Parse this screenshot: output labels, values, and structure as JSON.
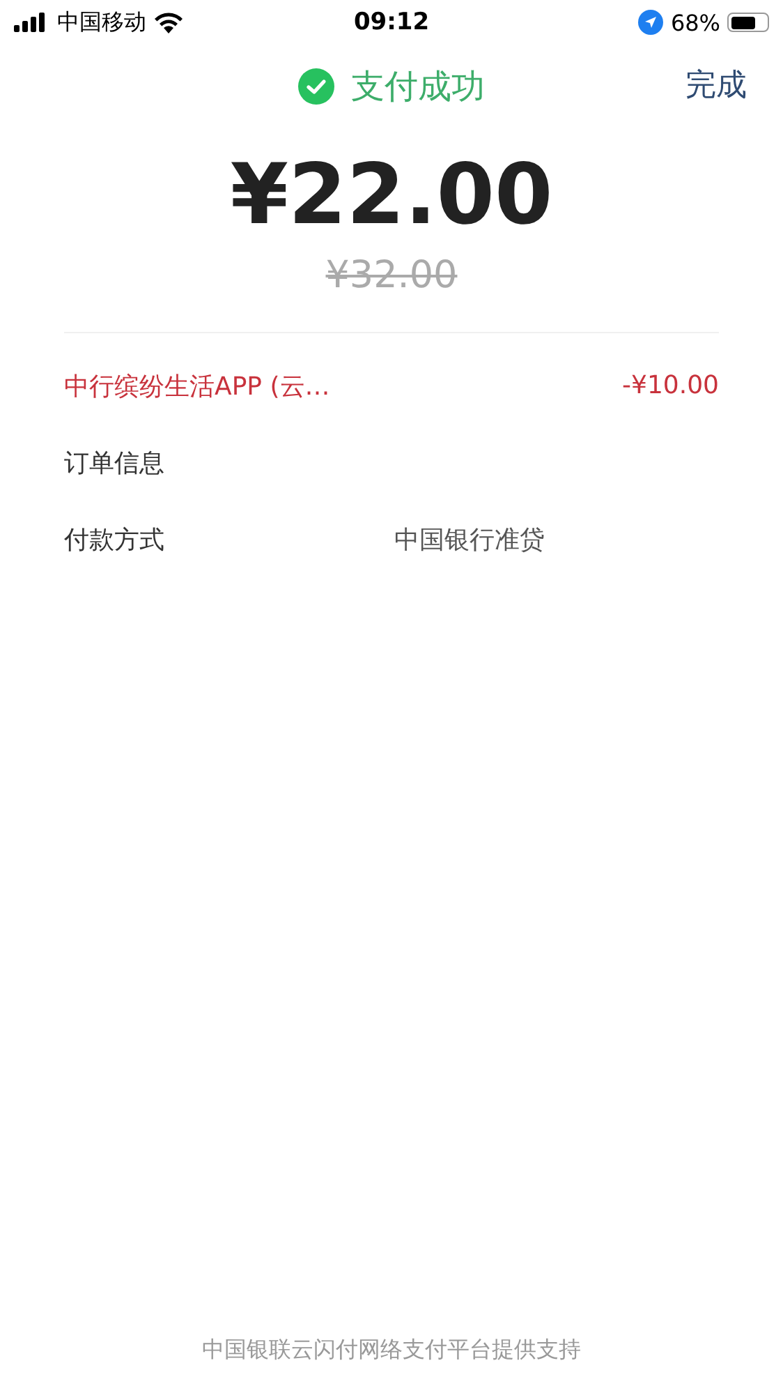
{
  "status_bar": {
    "carrier": "中国移动",
    "time": "09:12",
    "battery_percent": "68%"
  },
  "header": {
    "title": "支付成功",
    "done": "完成"
  },
  "amount": {
    "paid": "¥22.00",
    "original": "¥32.00"
  },
  "rows": [
    {
      "kind": "discount",
      "label": "中行缤纷生活APP (云…",
      "value": "-¥10.00"
    },
    {
      "kind": "info",
      "label": "订单信息"
    },
    {
      "kind": "info",
      "label": "付款方式",
      "value": "中国银行准贷"
    }
  ],
  "footer": "中国银联云闪付网络支付平台提供支持"
}
